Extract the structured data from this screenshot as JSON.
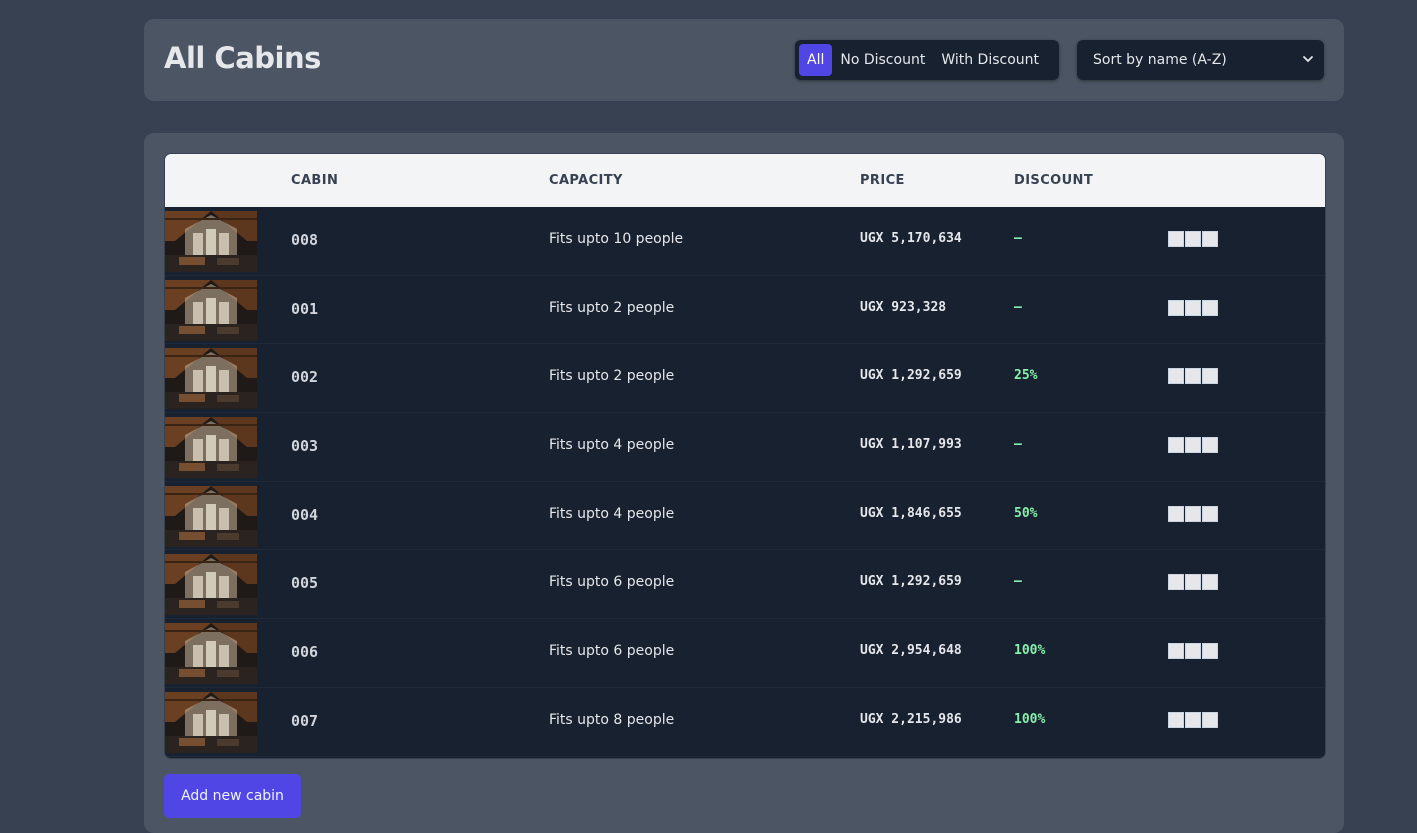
{
  "header": {
    "title": "All Cabins",
    "filters": [
      {
        "label": "All",
        "active": true
      },
      {
        "label": "No Discount",
        "active": false
      },
      {
        "label": "With Discount",
        "active": false
      }
    ],
    "sort": {
      "selected": "Sort by name (A-Z)"
    }
  },
  "table": {
    "columns": [
      "",
      "CABIN",
      "CAPACITY",
      "PRICE",
      "DISCOUNT",
      ""
    ],
    "rows": [
      {
        "name": "008",
        "capacity": "Fits upto 10 people",
        "price": "UGX 5,170,634",
        "discount": "–"
      },
      {
        "name": "001",
        "capacity": "Fits upto 2 people",
        "price": "UGX 923,328",
        "discount": "–"
      },
      {
        "name": "002",
        "capacity": "Fits upto 2 people",
        "price": "UGX 1,292,659",
        "discount": "25%"
      },
      {
        "name": "003",
        "capacity": "Fits upto 4 people",
        "price": "UGX 1,107,993",
        "discount": "–"
      },
      {
        "name": "004",
        "capacity": "Fits upto 4 people",
        "price": "UGX 1,846,655",
        "discount": "50%"
      },
      {
        "name": "005",
        "capacity": "Fits upto 6 people",
        "price": "UGX 1,292,659",
        "discount": "–"
      },
      {
        "name": "006",
        "capacity": "Fits upto 6 people",
        "price": "UGX 2,954,648",
        "discount": "100%"
      },
      {
        "name": "007",
        "capacity": "Fits upto 8 people",
        "price": "UGX 2,215,986",
        "discount": "100%"
      }
    ]
  },
  "actions": {
    "add_label": "Add new cabin"
  },
  "colors": {
    "accent": "#4f46e5",
    "surface": "#4b5563",
    "background": "#374151",
    "table_body": "#18212f",
    "discount": "#86efac"
  }
}
